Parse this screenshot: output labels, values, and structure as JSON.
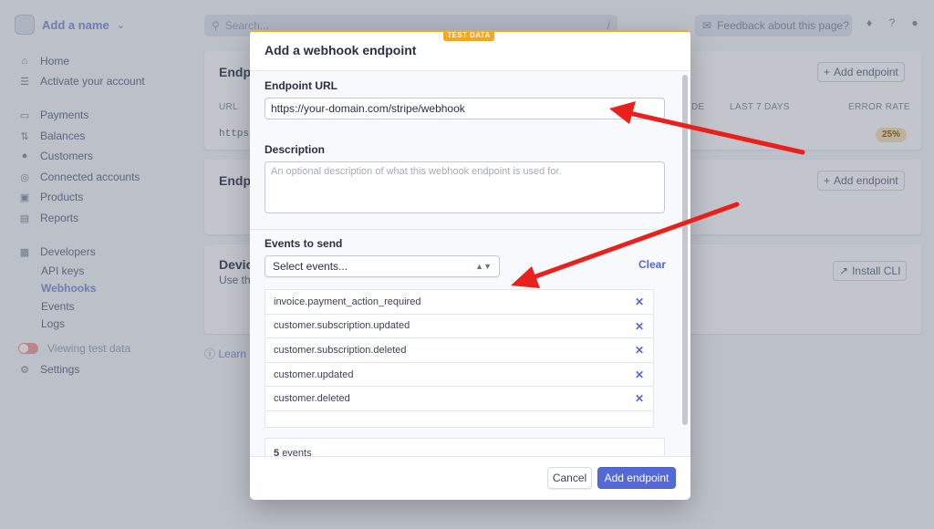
{
  "sidebar": {
    "brand": "Add a name",
    "nav_main": [
      {
        "label": "Home",
        "icon": "home-icon"
      },
      {
        "label": "Activate your account",
        "icon": "checklist-icon"
      }
    ],
    "nav_payments": [
      {
        "label": "Payments",
        "icon": "card-icon"
      },
      {
        "label": "Balances",
        "icon": "balance-icon"
      },
      {
        "label": "Customers",
        "icon": "user-icon"
      },
      {
        "label": "Connected accounts",
        "icon": "globe-icon"
      },
      {
        "label": "Products",
        "icon": "box-icon"
      },
      {
        "label": "Reports",
        "icon": "report-icon"
      }
    ],
    "developers": {
      "label": "Developers",
      "items": [
        "API keys",
        "Webhooks",
        "Events",
        "Logs"
      ],
      "active": "Webhooks"
    },
    "viewing_test_data": "Viewing test data",
    "settings": "Settings"
  },
  "topbar": {
    "search_placeholder": "Search...",
    "search_shortcut": "/",
    "feedback": "Feedback about this page?"
  },
  "background": {
    "card1_title": "Endpo",
    "card2_title": "Endpo",
    "card3_title": "Devic",
    "card3_sub": "Use th",
    "add_endpoint": "Add endpoint",
    "install_cli": "Install CLI",
    "columns": {
      "url": "URL",
      "mode_fragment": "DE",
      "last7": "LAST 7 DAYS",
      "error": "ERROR RATE"
    },
    "url_fragment": "https",
    "error_rate": "25%",
    "learn_more": "Learn m"
  },
  "modal": {
    "test_badge": "TEST DATA",
    "title": "Add a webhook endpoint",
    "endpoint_label": "Endpoint URL",
    "endpoint_value": "https://your-domain.com/stripe/webhook",
    "description_label": "Description",
    "description_placeholder": "An optional description of what this webhook endpoint is used for.",
    "events_label": "Events to send",
    "select_placeholder": "Select events...",
    "clear": "Clear",
    "events": [
      "invoice.payment_action_required",
      "customer.subscription.updated",
      "customer.subscription.deleted",
      "customer.updated",
      "customer.deleted"
    ],
    "events_count": "5",
    "events_count_label": "events",
    "cancel": "Cancel",
    "add_endpoint": "Add endpoint"
  },
  "colors": {
    "accent": "#5469d4",
    "test_orange": "#f5a623",
    "arrow_red": "#e8211d"
  }
}
